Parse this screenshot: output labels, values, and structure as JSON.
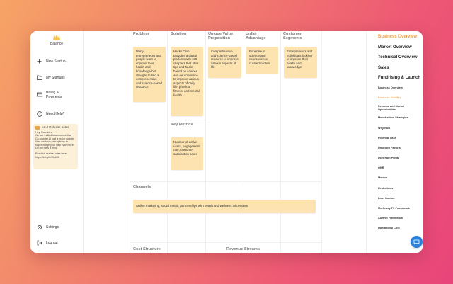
{
  "app": {
    "logo_text": "Balance"
  },
  "sidebar": {
    "items": [
      {
        "label": "New Startup",
        "icon": "plus-icon"
      },
      {
        "label": "My Startups",
        "icon": "folder-icon"
      },
      {
        "label": "Billing &\nPayments",
        "icon": "card-icon"
      },
      {
        "label": "Need Help?",
        "icon": "help-icon"
      }
    ],
    "release_notes": {
      "title": "v.0.2 Release notes",
      "body": "Hey, Founders!\nWe are thrilled to announce that Co-founder AI had a major update. Now we have paid options to supercharge your idea even more!\nDo not miss a thing.",
      "footer": "Read full realise notes here:\nhttps://bit.ly/3GfbdC3"
    },
    "bottom": [
      {
        "label": "Settings",
        "icon": "gear-icon"
      },
      {
        "label": "Log out",
        "icon": "logout-icon"
      }
    ]
  },
  "canvas": {
    "columns": {
      "problem": {
        "heading": "Problem",
        "note": "Many entrepreneurs and people want to improve their health and knowledge but struggle to find a comprehensive and science-based resource."
      },
      "solution": {
        "heading": "Solution",
        "note": "Hacks Club provides a digital platform with 100 chapters that offer tips and hacks based on science and neuroscience to improve various aspects of daily life, physical fitness, and mental health."
      },
      "uvp": {
        "heading": "Unique Value Proposition",
        "note": "Comprehensive and science-based resource to improve various aspects of life"
      },
      "unfair": {
        "heading": "Unfair Advantage",
        "note": "Expertise in science and neuroscience, curated content"
      },
      "segments": {
        "heading": "Customer Segments",
        "note": "Entrepreneurs and individuals looking to improve their health and knowledge"
      }
    },
    "key_metrics": {
      "heading": "Key Metrics",
      "note": "Number of active users, engagement rate, customer satisfaction score"
    },
    "channels": {
      "heading": "Channels",
      "note": "Online marketing, social media, partnerships with health and wellness influencers"
    },
    "cost_structure": {
      "heading": "Cost Structure"
    },
    "revenue_streams": {
      "heading": "Revenue Streams"
    }
  },
  "right_panel": {
    "sections": [
      {
        "label": "Business Overview",
        "active": true
      },
      {
        "label": "Market Overview",
        "active": false
      },
      {
        "label": "Technical Overview",
        "active": false
      },
      {
        "label": "Sales",
        "active": false
      },
      {
        "label": "Fundrising & Launch",
        "active": false
      }
    ],
    "subsections": [
      {
        "label": "Business Overview",
        "active": false
      },
      {
        "label": "Business Viability",
        "active": true
      },
      {
        "label": "Revenue and Market\nOpportunities",
        "active": false
      },
      {
        "label": "Monetization Strategies",
        "active": false
      },
      {
        "label": "Why Now",
        "active": false
      },
      {
        "label": "Potential risks",
        "active": false
      },
      {
        "label": "Unknown Factors",
        "active": false
      },
      {
        "label": "User Pain Points",
        "active": false
      },
      {
        "label": "OKR",
        "active": false
      },
      {
        "label": "Metrics",
        "active": false
      },
      {
        "label": "First clients",
        "active": false
      },
      {
        "label": "Lean Canvas",
        "active": false
      },
      {
        "label": "McKinsey 7S Framework",
        "active": false
      },
      {
        "label": "AARRR Framework",
        "active": false
      },
      {
        "label": "Operational Cost",
        "active": false
      }
    ]
  },
  "colors": {
    "accent": "#f0a04a",
    "sticky": "#fde3b0",
    "chat": "#2c7fd8"
  }
}
